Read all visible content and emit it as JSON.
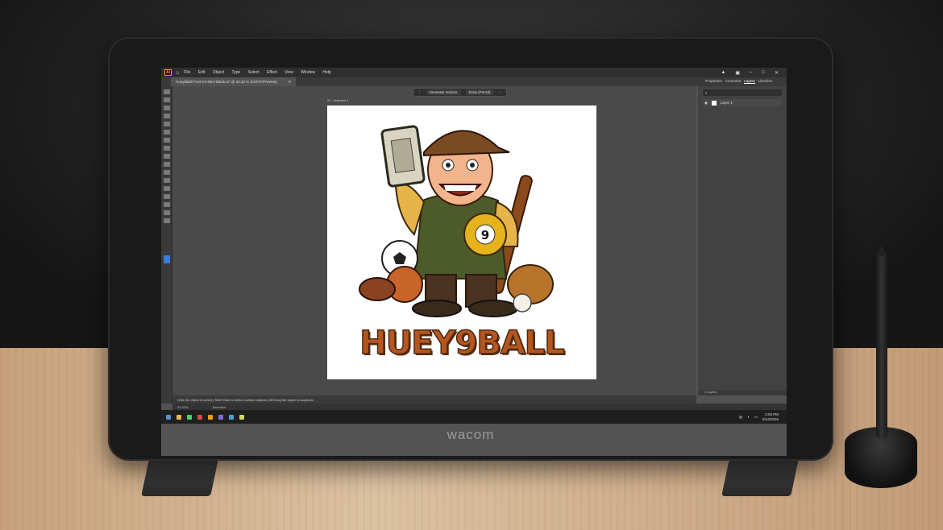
{
  "device": {
    "brand": "wacom"
  },
  "app": {
    "logo": "Ai",
    "menu": [
      "File",
      "Edit",
      "Object",
      "Type",
      "Select",
      "Effect",
      "View",
      "Window",
      "Help"
    ],
    "document_tab": "Huey9Ball-Post-V3-REV-Black.ai* @ 33.33 % (CMYK/Preview)",
    "panel_tabs": [
      "Properties",
      "Comment",
      "Layers",
      "Libraries"
    ],
    "context_bar": {
      "generate": "Generate Vectors",
      "draw": "Draw (Pencil)"
    },
    "artboard_label": "01 - Artboard 1",
    "artwork_title": "HUEY9BALL",
    "layers_panel": {
      "layer_name": "Layer 1",
      "footer": "1 Layers"
    },
    "status_hint": "Click the object to select  |  Shift+Click to select multiple objects  |  Alt+Drag the object to duplicate",
    "zoom": "33.33%",
    "tool_readout": "Selection"
  },
  "taskbar": {
    "time": "2:00 PM",
    "date": "5/14/2026"
  },
  "colors": {
    "accent": "#3d7ddb",
    "ai_orange": "#ff9a00",
    "title_brown": "#b5561f"
  }
}
